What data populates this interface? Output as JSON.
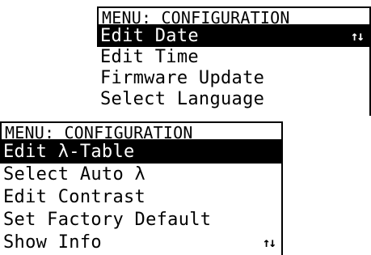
{
  "top_menu": {
    "title": "MENU: CONFIGURATION",
    "items": [
      {
        "label": "Edit Date",
        "selected": true
      },
      {
        "label": "Edit Time",
        "selected": false
      },
      {
        "label": "Firmware Update",
        "selected": false
      },
      {
        "label": "Select Language",
        "selected": false
      }
    ],
    "scroll_indicator": "↑↓"
  },
  "bottom_menu": {
    "title": "MENU: CONFIGURATION",
    "items": [
      {
        "label": "Edit λ-Table",
        "selected": true
      },
      {
        "label": "Select Auto λ",
        "selected": false
      },
      {
        "label": "Edit Contrast",
        "selected": false
      },
      {
        "label": "Set Factory Default",
        "selected": false
      },
      {
        "label": "Show Info",
        "selected": false
      }
    ],
    "scroll_indicator": "↑↓"
  },
  "colors": {
    "foreground": "#000000",
    "background": "#ffffff"
  }
}
